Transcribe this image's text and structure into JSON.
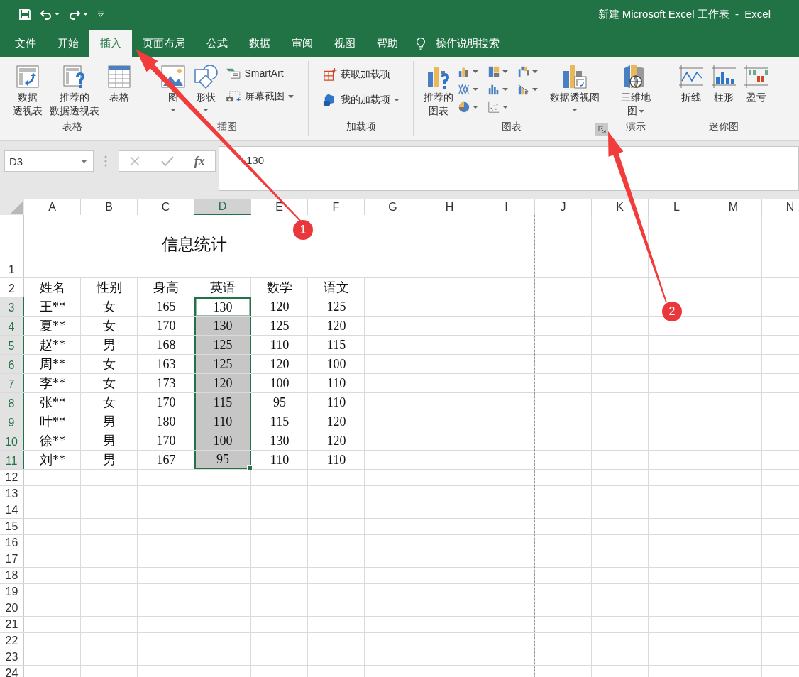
{
  "window": {
    "title": "新建 Microsoft Excel 工作表  -  Excel"
  },
  "quick_access": [
    {
      "dropdown": false
    },
    {
      "dropdown": true
    },
    {
      "dropdown": true
    },
    {
      "dropdown": false
    }
  ],
  "tabs": [
    {
      "label": "文件",
      "selected": false
    },
    {
      "label": "开始",
      "selected": false
    },
    {
      "label": "插入",
      "selected": true
    },
    {
      "label": "页面布局",
      "selected": false
    },
    {
      "label": "公式",
      "selected": false
    },
    {
      "label": "数据",
      "selected": false
    },
    {
      "label": "审阅",
      "selected": false
    },
    {
      "label": "视图",
      "selected": false
    },
    {
      "label": "帮助",
      "selected": false
    }
  ],
  "tell_me": "操作说明搜索",
  "ribbon": {
    "groups": [
      {
        "label": "表格",
        "launcher": false,
        "columns": [
          [
            {
              "kind": "large",
              "lines": [
                "数据",
                "透视表"
              ],
              "dropdown": false
            }
          ],
          [
            {
              "kind": "large",
              "lines": [
                "推荐的",
                "数据透视表"
              ],
              "dropdown": false
            }
          ],
          [
            {
              "kind": "large",
              "lines": [
                "表格"
              ],
              "dropdown": false
            }
          ]
        ]
      },
      {
        "label": "插图",
        "launcher": false,
        "columns": [
          [
            {
              "kind": "large",
              "lines": [
                "图"
              ],
              "dropdown": true
            }
          ],
          [
            {
              "kind": "large",
              "lines": [
                "形状"
              ],
              "dropdown": true
            }
          ],
          [
            {
              "kind": "small",
              "lines": [
                "SmartArt"
              ],
              "dropdown": false
            },
            {
              "kind": "small",
              "lines": [
                "屏幕截图"
              ],
              "dropdown": true
            }
          ]
        ]
      },
      {
        "label": "加载项",
        "launcher": false,
        "columns": [
          [
            {
              "kind": "small",
              "lines": [
                "获取加载项"
              ],
              "dropdown": false
            },
            {
              "kind": "small",
              "lines": [
                "我的加载项"
              ],
              "dropdown": true
            }
          ]
        ]
      },
      {
        "label": "图表",
        "launcher": true,
        "columns": [
          [
            {
              "kind": "large",
              "lines": [
                "推荐的",
                "图表"
              ],
              "dropdown": false
            }
          ],
          [
            {
              "kind": "gallery",
              "charts": [
                {
                  "dropdown": true
                },
                {
                  "dropdown": true
                },
                {
                  "dropdown": true
                },
                {
                  "dropdown": true
                },
                {
                  "dropdown": true
                },
                {
                  "dropdown": true
                },
                {
                  "dropdown": true
                },
                {
                  "dropdown": true
                }
              ]
            }
          ],
          [
            {
              "kind": "large",
              "lines": [
                "数据透视图"
              ],
              "dropdown": true
            }
          ]
        ]
      },
      {
        "label": "演示",
        "launcher": false,
        "columns": [
          [
            {
              "kind": "large",
              "lines": [
                "三维地",
                "图"
              ],
              "dropdown": true
            }
          ]
        ]
      },
      {
        "label": "迷你图",
        "launcher": false,
        "columns": [
          [
            {
              "kind": "large",
              "lines": [
                "折线"
              ],
              "dropdown": false
            }
          ],
          [
            {
              "kind": "large",
              "lines": [
                "柱形"
              ],
              "dropdown": false
            }
          ],
          [
            {
              "kind": "large",
              "lines": [
                "盈亏"
              ],
              "dropdown": false
            }
          ]
        ]
      }
    ]
  },
  "formula_bar": {
    "name_box": "D3",
    "function_label": "fx",
    "value": "130"
  },
  "sheet": {
    "columns": [
      {
        "label": "A",
        "selected": false,
        "page_break": false
      },
      {
        "label": "B",
        "selected": false,
        "page_break": false
      },
      {
        "label": "C",
        "selected": false,
        "page_break": false
      },
      {
        "label": "D",
        "selected": true,
        "page_break": false
      },
      {
        "label": "E",
        "selected": false,
        "page_break": false
      },
      {
        "label": "F",
        "selected": false,
        "page_break": false
      },
      {
        "label": "G",
        "selected": false,
        "page_break": false
      },
      {
        "label": "H",
        "selected": false,
        "page_break": false
      },
      {
        "label": "I",
        "selected": false,
        "page_break": true
      },
      {
        "label": "J",
        "selected": false,
        "page_break": false
      },
      {
        "label": "K",
        "selected": false,
        "page_break": false
      },
      {
        "label": "L",
        "selected": false,
        "page_break": false
      },
      {
        "label": "M",
        "selected": false,
        "page_break": false
      },
      {
        "label": "N",
        "selected": false,
        "page_break": false
      }
    ],
    "rows": [
      {
        "number": "1",
        "selected": false,
        "title": "信息统计"
      },
      {
        "number": "2",
        "selected": false,
        "cells": [
          {
            "value": "姓名",
            "selected": false,
            "active": false
          },
          {
            "value": "性别",
            "selected": false,
            "active": false
          },
          {
            "value": "身高",
            "selected": false,
            "active": false
          },
          {
            "value": "英语",
            "selected": false,
            "active": false
          },
          {
            "value": "数学",
            "selected": false,
            "active": false
          },
          {
            "value": "语文",
            "selected": false,
            "active": false
          }
        ]
      },
      {
        "number": "3",
        "selected": true,
        "cells": [
          {
            "value": "王**",
            "selected": false,
            "active": false
          },
          {
            "value": "女",
            "selected": false,
            "active": false
          },
          {
            "value": "165",
            "selected": false,
            "active": false
          },
          {
            "value": "130",
            "selected": true,
            "active": true
          },
          {
            "value": "120",
            "selected": false,
            "active": false
          },
          {
            "value": "125",
            "selected": false,
            "active": false
          }
        ]
      },
      {
        "number": "4",
        "selected": true,
        "cells": [
          {
            "value": "夏**",
            "selected": false,
            "active": false
          },
          {
            "value": "女",
            "selected": false,
            "active": false
          },
          {
            "value": "170",
            "selected": false,
            "active": false
          },
          {
            "value": "130",
            "selected": true,
            "active": false
          },
          {
            "value": "125",
            "selected": false,
            "active": false
          },
          {
            "value": "120",
            "selected": false,
            "active": false
          }
        ]
      },
      {
        "number": "5",
        "selected": true,
        "cells": [
          {
            "value": "赵**",
            "selected": false,
            "active": false
          },
          {
            "value": "男",
            "selected": false,
            "active": false
          },
          {
            "value": "168",
            "selected": false,
            "active": false
          },
          {
            "value": "125",
            "selected": true,
            "active": false
          },
          {
            "value": "110",
            "selected": false,
            "active": false
          },
          {
            "value": "115",
            "selected": false,
            "active": false
          }
        ]
      },
      {
        "number": "6",
        "selected": true,
        "cells": [
          {
            "value": "周**",
            "selected": false,
            "active": false
          },
          {
            "value": "女",
            "selected": false,
            "active": false
          },
          {
            "value": "163",
            "selected": false,
            "active": false
          },
          {
            "value": "125",
            "selected": true,
            "active": false
          },
          {
            "value": "120",
            "selected": false,
            "active": false
          },
          {
            "value": "100",
            "selected": false,
            "active": false
          }
        ]
      },
      {
        "number": "7",
        "selected": true,
        "cells": [
          {
            "value": "李**",
            "selected": false,
            "active": false
          },
          {
            "value": "女",
            "selected": false,
            "active": false
          },
          {
            "value": "173",
            "selected": false,
            "active": false
          },
          {
            "value": "120",
            "selected": true,
            "active": false
          },
          {
            "value": "100",
            "selected": false,
            "active": false
          },
          {
            "value": "110",
            "selected": false,
            "active": false
          }
        ]
      },
      {
        "number": "8",
        "selected": true,
        "cells": [
          {
            "value": "张**",
            "selected": false,
            "active": false
          },
          {
            "value": "女",
            "selected": false,
            "active": false
          },
          {
            "value": "170",
            "selected": false,
            "active": false
          },
          {
            "value": "115",
            "selected": true,
            "active": false
          },
          {
            "value": "95",
            "selected": false,
            "active": false
          },
          {
            "value": "110",
            "selected": false,
            "active": false
          }
        ]
      },
      {
        "number": "9",
        "selected": true,
        "cells": [
          {
            "value": "叶**",
            "selected": false,
            "active": false
          },
          {
            "value": "男",
            "selected": false,
            "active": false
          },
          {
            "value": "180",
            "selected": false,
            "active": false
          },
          {
            "value": "110",
            "selected": true,
            "active": false
          },
          {
            "value": "115",
            "selected": false,
            "active": false
          },
          {
            "value": "120",
            "selected": false,
            "active": false
          }
        ]
      },
      {
        "number": "10",
        "selected": true,
        "cells": [
          {
            "value": "徐**",
            "selected": false,
            "active": false
          },
          {
            "value": "男",
            "selected": false,
            "active": false
          },
          {
            "value": "170",
            "selected": false,
            "active": false
          },
          {
            "value": "100",
            "selected": true,
            "active": false
          },
          {
            "value": "130",
            "selected": false,
            "active": false
          },
          {
            "value": "120",
            "selected": false,
            "active": false
          }
        ]
      },
      {
        "number": "11",
        "selected": true,
        "cells": [
          {
            "value": "刘**",
            "selected": false,
            "active": false
          },
          {
            "value": "男",
            "selected": false,
            "active": false
          },
          {
            "value": "167",
            "selected": false,
            "active": false
          },
          {
            "value": "95",
            "selected": true,
            "active": false
          },
          {
            "value": "110",
            "selected": false,
            "active": false
          },
          {
            "value": "110",
            "selected": false,
            "active": false
          }
        ]
      },
      {
        "number": "12",
        "selected": false
      },
      {
        "number": "13",
        "selected": false
      },
      {
        "number": "14",
        "selected": false
      },
      {
        "number": "15",
        "selected": false
      },
      {
        "number": "16",
        "selected": false
      },
      {
        "number": "17",
        "selected": false
      },
      {
        "number": "18",
        "selected": false
      },
      {
        "number": "19",
        "selected": false
      },
      {
        "number": "20",
        "selected": false
      },
      {
        "number": "21",
        "selected": false
      },
      {
        "number": "22",
        "selected": false
      },
      {
        "number": "23",
        "selected": false
      },
      {
        "number": "24",
        "selected": false
      }
    ]
  },
  "annotations": [
    {
      "number": "1"
    },
    {
      "number": "2"
    }
  ]
}
